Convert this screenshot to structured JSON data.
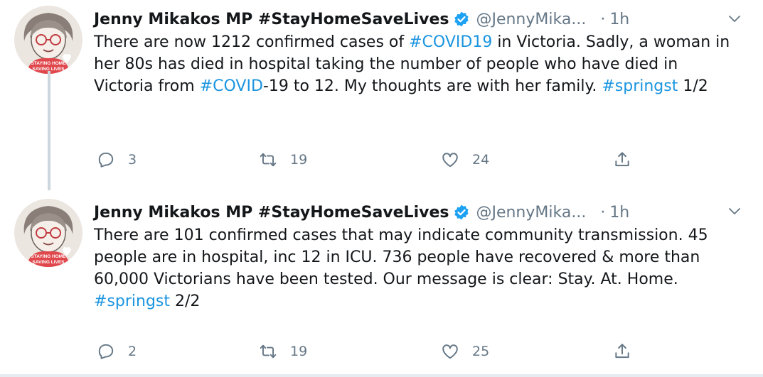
{
  "tweets": [
    {
      "author_name": "Jenny Mikakos MP #StayHomeSaveLives",
      "handle": "@JennyMika...",
      "separator": "·",
      "time": "1h",
      "avatar_badge_line1": "STAYING HOME",
      "avatar_badge_line2": "SAVING LIVES",
      "text": {
        "p1": "There are now 1212 confirmed cases of ",
        "h1": "#COVID19",
        "p2": " in Victoria. Sadly, a woman in her 80s has died in hospital taking the number of people who have died in Victoria from ",
        "h2": "#COVID",
        "p3": "-19 to 12. My thoughts are with her family. ",
        "h3": "#springst",
        "p4": " 1/2"
      },
      "replies": "3",
      "retweets": "19",
      "likes": "24"
    },
    {
      "author_name": "Jenny Mikakos MP #StayHomeSaveLives",
      "handle": "@JennyMika...",
      "separator": "·",
      "time": "1h",
      "avatar_badge_line1": "STAYING HOME",
      "avatar_badge_line2": "SAVING LIVES",
      "text": {
        "p1": "There are 101 confirmed cases that may indicate community transmission. 45 people are in hospital, inc 12 in ICU. 736 people have recovered & more than 60,000 Victorians have been tested. Our message is clear: Stay. At. Home. ",
        "h1": "#springst",
        "p2": " 2/2"
      },
      "replies": "2",
      "retweets": "19",
      "likes": "25"
    }
  ],
  "icons": {
    "verified": "verified-badge-icon",
    "caret": "chevron-down-icon",
    "reply": "reply-icon",
    "retweet": "retweet-icon",
    "like": "heart-icon",
    "share": "share-icon"
  },
  "colors": {
    "text": "#14171a",
    "secondary": "#657786",
    "link": "#1b95e0",
    "verified": "#1da1f2",
    "badge": "#e0474c",
    "thread_line": "#ccd6dd"
  }
}
